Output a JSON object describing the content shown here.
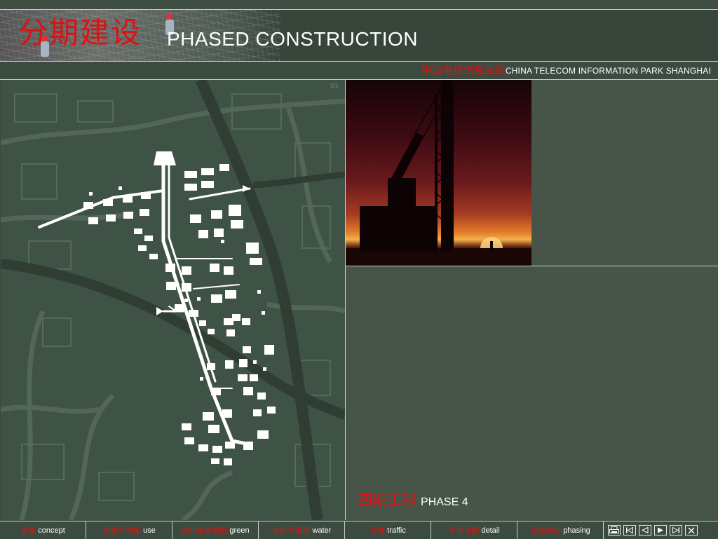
{
  "header": {
    "title_cn": "分期建设",
    "title_en": "PHASED CONSTRUCTION",
    "project_cn": "中国电信信息园区",
    "project_en": "CHINA TELECOM INFORMATION PARK SHANGHAI"
  },
  "map": {
    "page_number": "01"
  },
  "panel": {
    "phase_cn": "四期工程",
    "phase_en": "PHASE 4"
  },
  "nav": {
    "items": [
      {
        "cn": "方案",
        "en": "concept"
      },
      {
        "cn": "功能分布图",
        "en": "use"
      },
      {
        "cn": "绿化景方案图",
        "en": "green"
      },
      {
        "cn": "水系方案图",
        "en": "water"
      },
      {
        "cn": "交通",
        "en": "traffic"
      },
      {
        "cn": "节点详图",
        "en": "detail"
      },
      {
        "cn": "分期建设",
        "en": "phasing"
      }
    ],
    "controls": [
      "print-icon",
      "first-page-icon",
      "previous-page-icon",
      "next-page-icon",
      "last-page-icon",
      "close-icon"
    ]
  },
  "colors": {
    "accent_red": "#e01010",
    "background": "#3c4b40",
    "map_background": "#3f5246"
  }
}
